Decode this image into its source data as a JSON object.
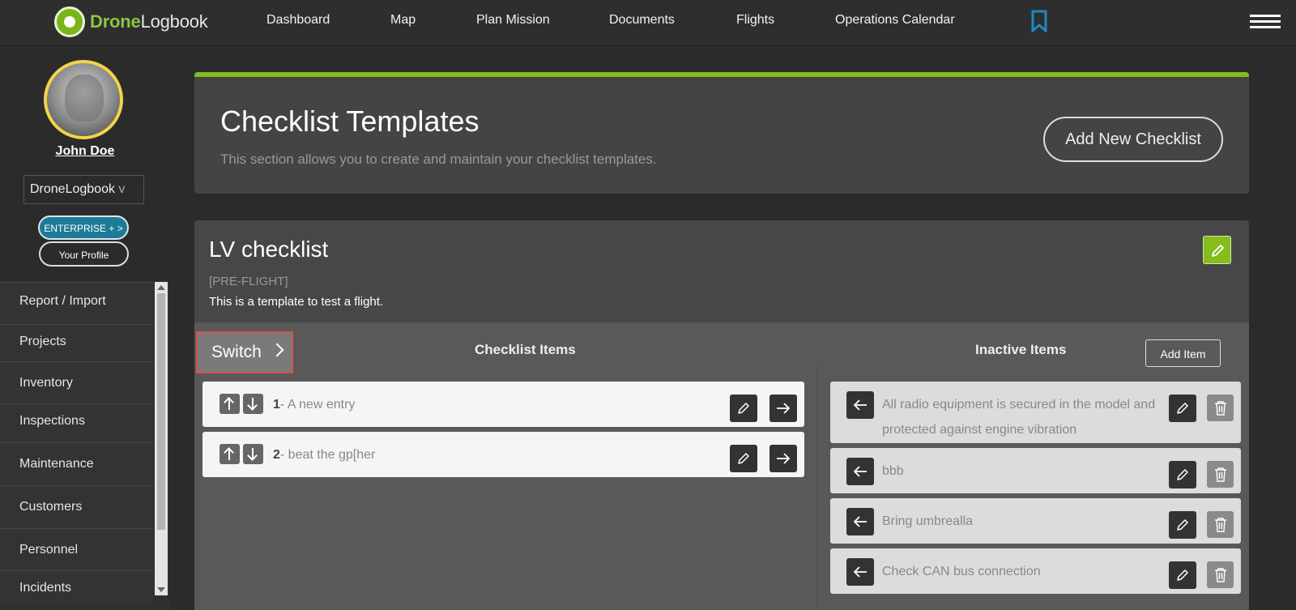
{
  "app": {
    "logo_bold": "Drone",
    "logo_rest": "Logbook"
  },
  "nav": {
    "items": [
      "Dashboard",
      "Map",
      "Plan Mission",
      "Documents",
      "Flights",
      "Operations Calendar"
    ]
  },
  "sidebar": {
    "username": "John Doe",
    "org_select": "DroneLogbook",
    "org_caret": "v",
    "enterprise_label": "ENTERPRISE + >",
    "profile_label": "Your Profile",
    "menu": [
      "Report / Import",
      "Projects",
      "Inventory",
      "Inspections",
      "Maintenance",
      "Customers",
      "Personnel",
      "Incidents"
    ]
  },
  "header": {
    "title": "Checklist Templates",
    "description": "This section allows you to create and maintain your checklist templates.",
    "add_button": "Add New Checklist"
  },
  "checklist": {
    "title": "LV checklist",
    "tag": "[PRE-FLIGHT]",
    "description": "This is a template to test a flight.",
    "switch_label": "Switch",
    "active_column_title": "Checklist Items",
    "inactive_column_title": "Inactive Items",
    "add_item_label": "Add Item",
    "active_items": [
      {
        "number": "1",
        "text": "- A new entry"
      },
      {
        "number": "2",
        "text": "- beat the gp[her"
      }
    ],
    "inactive_items": [
      {
        "text": "All radio equipment is secured in the model and protected against engine vibration"
      },
      {
        "text": "bbb"
      },
      {
        "text": "Bring umbrealla"
      },
      {
        "text": "Check CAN bus connection"
      }
    ]
  },
  "colors": {
    "accent_green": "#84bd1d",
    "enterprise_blue": "#1e7b98",
    "highlight_red": "#d9534f",
    "bookmark_blue": "#1e88c7"
  }
}
